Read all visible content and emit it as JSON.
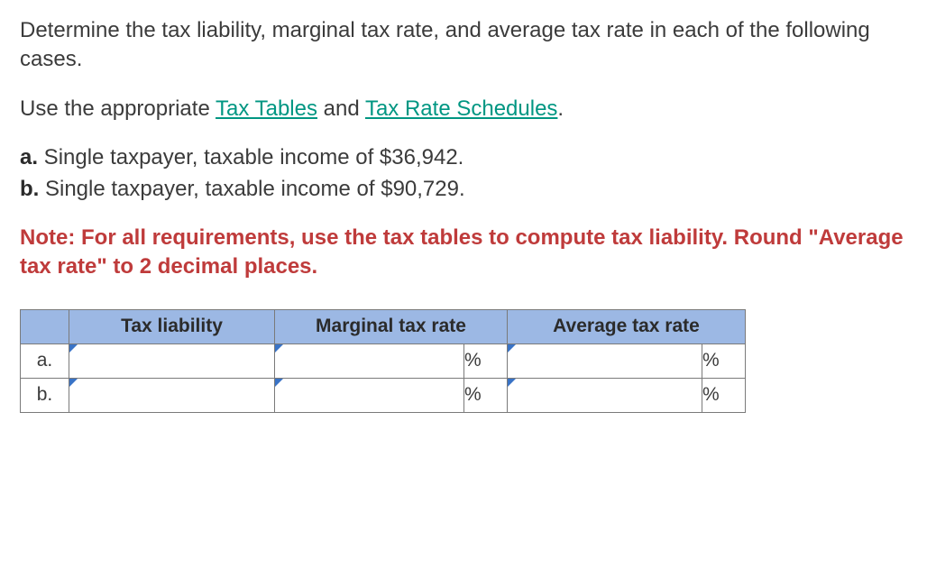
{
  "intro": {
    "line1": "Determine the tax liability, marginal tax rate, and average tax rate in each of the following cases.",
    "prefix": "Use the appropriate ",
    "link1": "Tax Tables",
    "mid": " and ",
    "link2": "Tax Rate Schedules",
    "suffix": "."
  },
  "items": {
    "a_label": "a.",
    "a_text": " Single taxpayer, taxable income of $36,942.",
    "b_label": "b.",
    "b_text": " Single taxpayer, taxable income of $90,729."
  },
  "note": "Note: For all requirements, use the tax tables to compute tax liability. Round \"Average tax rate\" to 2 decimal places.",
  "table": {
    "headers": {
      "liability": "Tax liability",
      "marginal": "Marginal tax rate",
      "average": "Average tax rate"
    },
    "rows": {
      "a": {
        "label": "a.",
        "liability": "",
        "marginal": "",
        "marginal_unit": "%",
        "average": "",
        "average_unit": "%"
      },
      "b": {
        "label": "b.",
        "liability": "",
        "marginal": "",
        "marginal_unit": "%",
        "average": "",
        "average_unit": "%"
      }
    }
  }
}
